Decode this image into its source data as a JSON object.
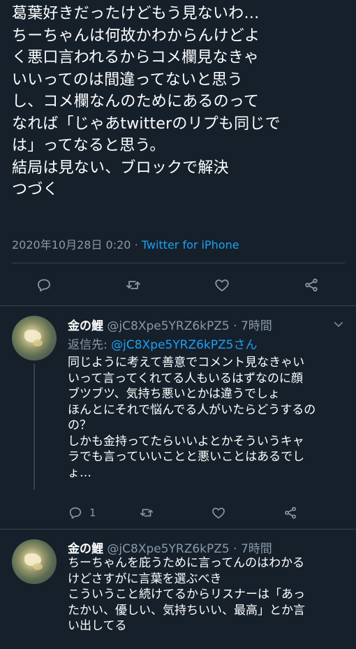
{
  "main_tweet": {
    "text": "葛葉好きだったけどもう見ないわ…\nちーちゃんは何故かわからんけどよ\nく悪口言われるからコメ欄見なきゃ\nいいってのは間違ってないと思う\nし、コメ欄なんのためにあるのって\nなれば「じゃあtwitterのリプも同じで\nは」ってなると思う。\n結局は見ない、ブロックで解決\nつづく",
    "timestamp": "2020年10月28日 0:20",
    "separator": "·",
    "source": "Twitter for iPhone",
    "actions": {
      "reply_icon": "reply-icon",
      "retweet_icon": "retweet-icon",
      "like_icon": "heart-icon",
      "share_icon": "share-icon"
    }
  },
  "replies": [
    {
      "name": "金の鯉",
      "handle": "@jC8Xpe5YRZ6kPZ5",
      "separator": "·",
      "time": "7時間",
      "reply_to_label": "返信先:",
      "reply_to_handle": "@jC8Xpe5YRZ6kPZ5さん",
      "text": "同じように考えて善意でコメント見なきゃい\nいって言ってくれてる人もいるはずなのに顔\nブツブツ、気持ち悪いとかは違うでしょ\nほんとにそれで悩んでる人がいたらどうするの\nの？\nしかも金持ってたらいいよとかそういうキャ\nラでも言っていいことと悪いことはあるでし\nょ…",
      "reply_count": "1"
    },
    {
      "name": "金の鯉",
      "handle": "@jC8Xpe5YRZ6kPZ5",
      "separator": "·",
      "time": "7時間",
      "text": "ちーちゃんを庇うために言ってんのはわかる\nけどさすがに言葉を選ぶべき\nこういうこと続けてるからリスナーは「あっ\nたかい、優しい、気持ちいい、最高」とか言\nい出してる"
    }
  ],
  "colors": {
    "background": "#15202b",
    "text": "#ffffff",
    "muted": "#8899a6",
    "accent": "#1da1f2",
    "divider": "#38444d"
  }
}
